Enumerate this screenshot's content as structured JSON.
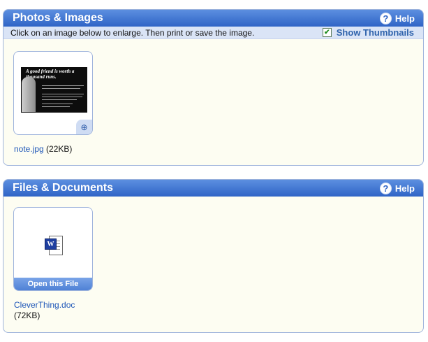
{
  "photos_panel": {
    "title": "Photos & Images",
    "help_label": "Help",
    "instruction": "Click on an image below to enlarge. Then print or save the image.",
    "show_thumbnails_label": "Show Thumbnails",
    "show_thumbnails_checked": true,
    "image": {
      "headline": "A good friend is worth a thousand runs.",
      "file_name": "note.jpg",
      "file_size": "(22KB)"
    }
  },
  "files_panel": {
    "title": "Files & Documents",
    "help_label": "Help",
    "file": {
      "open_label": "Open this File",
      "file_name": "CleverThing.doc",
      "file_size": "(72KB)"
    }
  },
  "colors": {
    "header_blue": "#2f64c6",
    "link_blue": "#1f57b8",
    "panel_bg": "#fdfdf2"
  }
}
